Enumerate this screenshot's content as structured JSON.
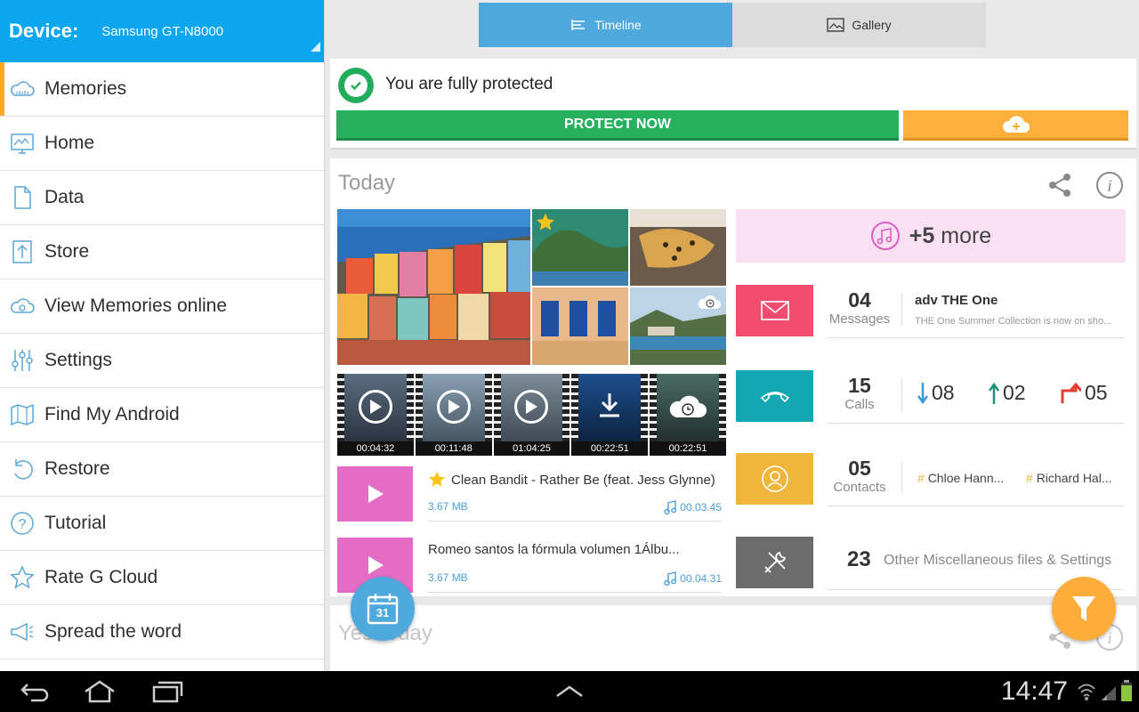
{
  "device": {
    "label": "Device:",
    "name": "Samsung GT-N8000"
  },
  "sidebar": {
    "items": [
      {
        "label": "Memories",
        "icon": "cloud-memories-icon",
        "active": true
      },
      {
        "label": "Home",
        "icon": "home-chart-icon"
      },
      {
        "label": "Data",
        "icon": "document-icon"
      },
      {
        "label": "Store",
        "icon": "upload-icon"
      },
      {
        "label": "View Memories online",
        "icon": "cloud-online-icon"
      },
      {
        "label": "Settings",
        "icon": "sliders-icon"
      },
      {
        "label": "Find My Android",
        "icon": "map-icon"
      },
      {
        "label": "Restore",
        "icon": "restore-icon"
      },
      {
        "label": "Tutorial",
        "icon": "help-icon"
      },
      {
        "label": "Rate G Cloud",
        "icon": "star-icon"
      },
      {
        "label": "Spread the word",
        "icon": "megaphone-icon"
      }
    ]
  },
  "tabs": {
    "timeline": "Timeline",
    "gallery": "Gallery"
  },
  "protect": {
    "status": "You are fully protected",
    "button": "PROTECT NOW"
  },
  "today": {
    "title": "Today",
    "videos": [
      "00:04:32",
      "00:11:48",
      "01:04:25",
      "00:22:51",
      "00:22:51"
    ],
    "music": [
      {
        "title": "Clean Bandit - Rather Be (feat. Jess Glynne)",
        "size": "3.67 MB",
        "duration": "00.03.45",
        "starred": true
      },
      {
        "title": "Romeo santos la fórmula volumen 1Álbu...",
        "size": "3.67 MB",
        "duration": "00.04.31",
        "starred": false
      }
    ],
    "more": {
      "count": "+5",
      "label": "more"
    },
    "messages": {
      "count": "04",
      "label": "Messages",
      "sender": "adv THE One",
      "preview": "THE One Summer Collection is now on sho..."
    },
    "calls": {
      "count": "15",
      "label": "Calls",
      "incoming": "08",
      "outgoing": "02",
      "missed": "05"
    },
    "contacts": {
      "count": "05",
      "label": "Contacts",
      "names": [
        "Chloe Hann...",
        "Richard Hal..."
      ]
    },
    "other": {
      "count": "23",
      "label": "Other Miscellaneous files & Settings"
    }
  },
  "yesterday": {
    "title": "Yesterday"
  },
  "calendar_day": "31",
  "system": {
    "time": "14:47"
  },
  "colors": {
    "primary": "#0ba6ee",
    "accent": "#ffa92a",
    "green": "#27b15f",
    "messages": "#ef4c6e",
    "calls": "#12a7b3",
    "contacts": "#f0b63c",
    "other": "#6c6c6c",
    "music": "#e46bc6"
  }
}
